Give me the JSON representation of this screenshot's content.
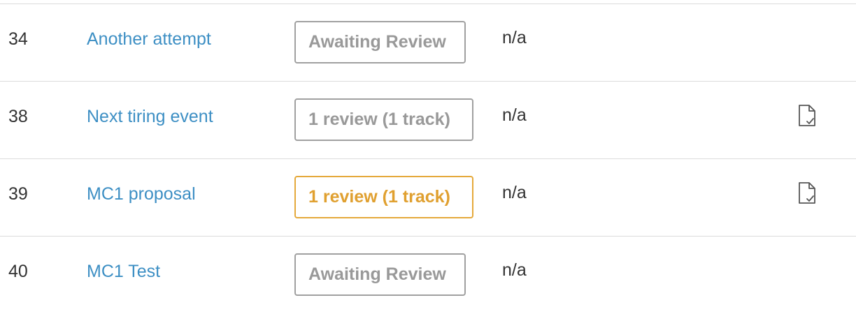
{
  "rows": [
    {
      "id": "34",
      "title": "Another attempt",
      "status": "Awaiting Review",
      "status_kind": "neutral",
      "value": "n/a",
      "has_doc_icon": false
    },
    {
      "id": "38",
      "title": "Next tiring event",
      "status": "1 review (1 track)",
      "status_kind": "neutral",
      "value": "n/a",
      "has_doc_icon": true
    },
    {
      "id": "39",
      "title": "MC1 proposal",
      "status": "1 review (1 track)",
      "status_kind": "warning",
      "value": "n/a",
      "has_doc_icon": true
    },
    {
      "id": "40",
      "title": "MC1 Test",
      "status": "Awaiting Review",
      "status_kind": "neutral",
      "value": "n/a",
      "has_doc_icon": false
    }
  ],
  "colors": {
    "link": "#3d8fc4",
    "neutral_badge": "#999999",
    "warning_badge": "#e0a030",
    "divider": "#dcdcdc"
  },
  "icons": {
    "review_doc": "document-check-icon"
  }
}
